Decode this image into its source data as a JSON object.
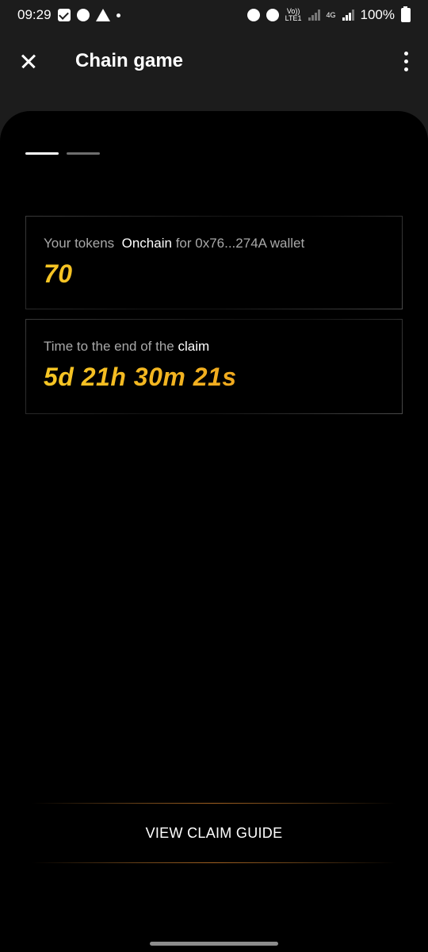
{
  "status_bar": {
    "time": "09:29",
    "volte_label": "Vo))",
    "lte_label": "LTE1",
    "net_label": "4G",
    "battery": "100%"
  },
  "app_bar": {
    "title": "Chain game"
  },
  "pager": {
    "total": 2,
    "active_index": 0
  },
  "tokens_card": {
    "label_prefix": "Your tokens",
    "label_highlight": "Onchain",
    "label_suffix": "for 0x76...274A wallet",
    "value": "70"
  },
  "claim_card": {
    "label_prefix": "Time to the end of the",
    "label_highlight": "claim",
    "value": "5d 21h 30m 21s"
  },
  "footer": {
    "guide_button": "VIEW CLAIM GUIDE"
  },
  "colors": {
    "accent_gold": "#f2b92a",
    "sheet_background": "#000000",
    "app_background": "#1c1c1c"
  }
}
